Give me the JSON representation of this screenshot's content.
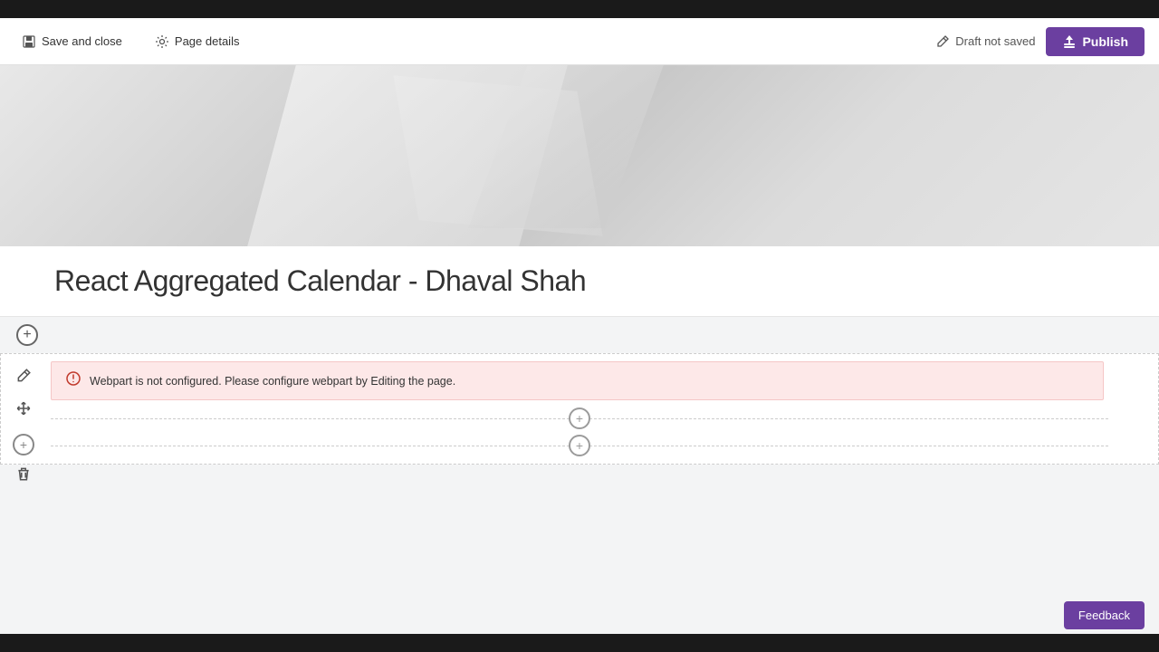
{
  "topBar": {},
  "toolbar": {
    "saveAndClose": "Save and close",
    "pageDetails": "Page details",
    "draftStatus": "Draft not saved",
    "publishLabel": "Publish"
  },
  "hero": {
    "title": "React Aggregated Calendar - Dhaval Shah"
  },
  "errorBanner": {
    "message": "Webpart is not configured. Please configure webpart by Editing the page."
  },
  "feedback": {
    "label": "Feedback"
  },
  "sideTools": {
    "edit": "✏",
    "move": "✥",
    "delete": "🗑"
  }
}
